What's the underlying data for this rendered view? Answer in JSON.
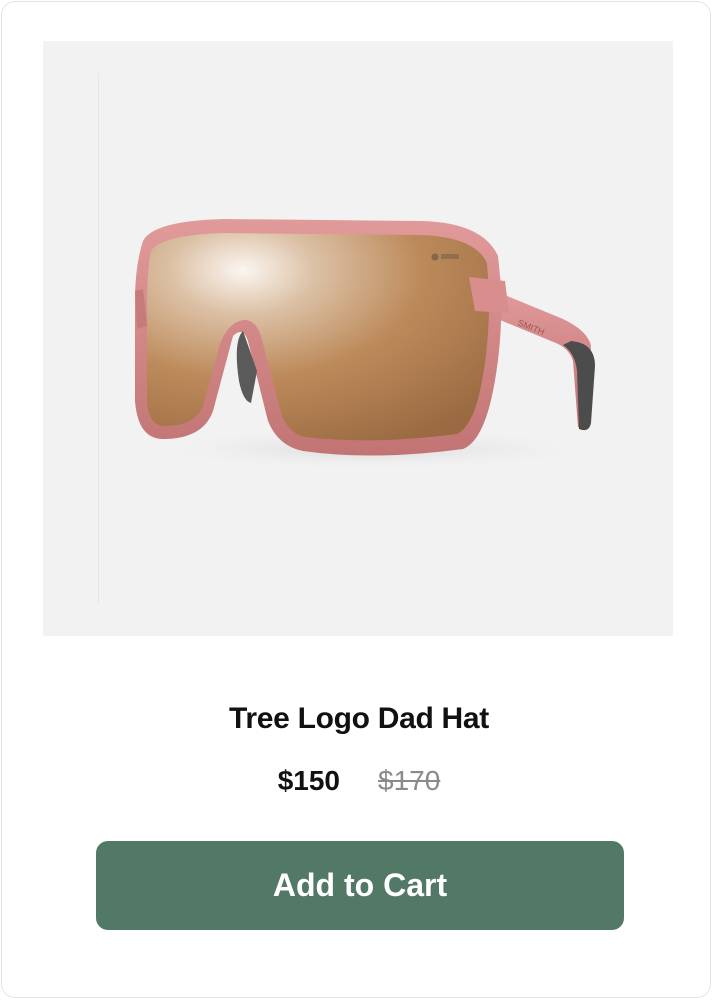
{
  "product": {
    "image_icon": "sunglasses-product-image",
    "brand_mark_text": "SMITH",
    "title": "Tree Logo Dad Hat",
    "price": "$150",
    "original_price": "$170"
  },
  "actions": {
    "add_to_cart_label": "Add to Cart"
  },
  "colors": {
    "button": "#527866",
    "image_background": "#f2f2f2",
    "frame": "#cf8282",
    "lens": "#b98756"
  }
}
